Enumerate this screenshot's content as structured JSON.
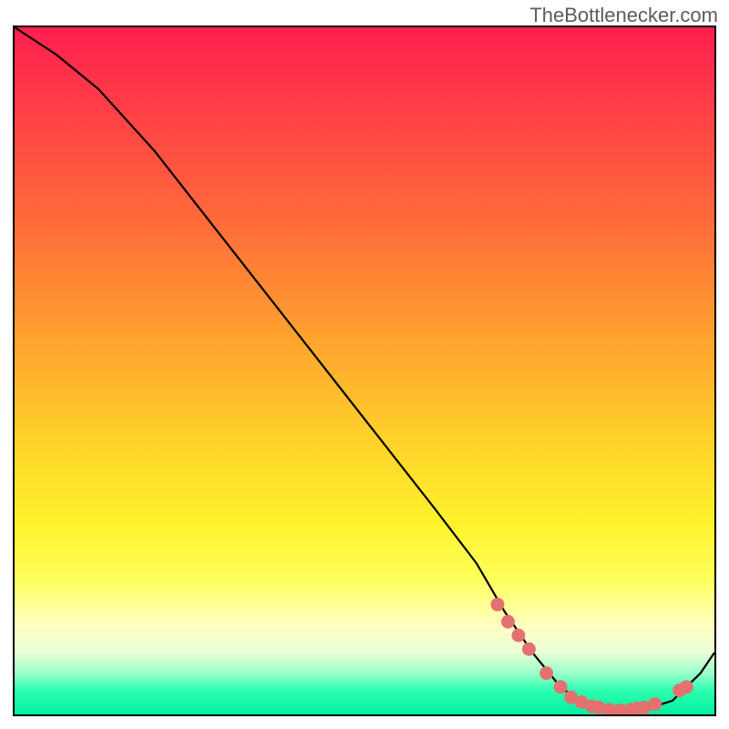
{
  "attribution": "TheBottlenecker.com",
  "chart_data": {
    "type": "line",
    "title": "",
    "xlabel": "",
    "ylabel": "",
    "xlim": [
      0,
      100
    ],
    "ylim": [
      0,
      100
    ],
    "series": [
      {
        "name": "curve",
        "x": [
          0,
          6,
          12,
          20,
          30,
          40,
          50,
          60,
          66,
          70,
          74,
          78,
          82,
          86,
          90,
          94,
          98,
          100
        ],
        "y": [
          100,
          96,
          91,
          82,
          69,
          56,
          43,
          30,
          22,
          15,
          9,
          4,
          1,
          0.5,
          0.7,
          2,
          6,
          9
        ]
      }
    ],
    "markers": [
      {
        "x": 69.0,
        "y": 16.0
      },
      {
        "x": 70.5,
        "y": 13.5
      },
      {
        "x": 72.0,
        "y": 11.5
      },
      {
        "x": 73.5,
        "y": 9.5
      },
      {
        "x": 76.0,
        "y": 6.0
      },
      {
        "x": 78.0,
        "y": 4.0
      },
      {
        "x": 79.5,
        "y": 2.5
      },
      {
        "x": 81.0,
        "y": 1.8
      },
      {
        "x": 82.5,
        "y": 1.2
      },
      {
        "x": 83.5,
        "y": 1.0
      },
      {
        "x": 85.0,
        "y": 0.7
      },
      {
        "x": 86.5,
        "y": 0.6
      },
      {
        "x": 88.0,
        "y": 0.7
      },
      {
        "x": 89.0,
        "y": 0.9
      },
      {
        "x": 90.0,
        "y": 1.0
      },
      {
        "x": 91.5,
        "y": 1.5
      },
      {
        "x": 95.0,
        "y": 3.5
      },
      {
        "x": 96.0,
        "y": 4.0
      }
    ],
    "marker_color": "#e4716f",
    "curve_color": "#000000"
  }
}
